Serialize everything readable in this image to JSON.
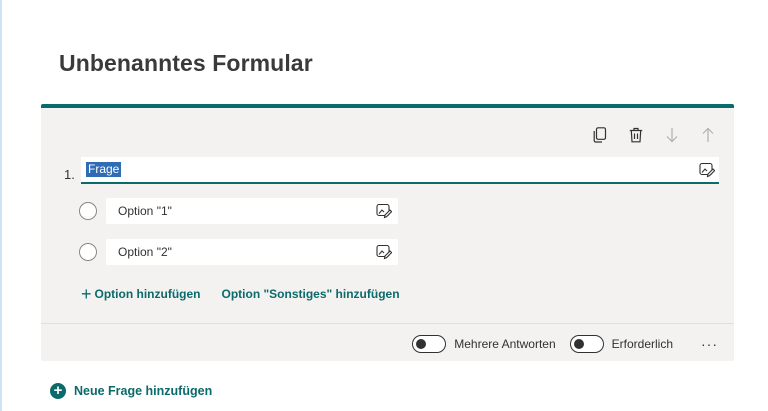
{
  "form": {
    "title": "Unbenanntes Formular"
  },
  "question": {
    "number": "1.",
    "text": "Frage",
    "options": [
      {
        "label": "Option \"1\""
      },
      {
        "label": "Option \"2\""
      }
    ],
    "add_option_label": "Option hinzufügen",
    "add_other_label": "Option \"Sonstiges\" hinzufügen",
    "toolbar_icons": [
      "copy-icon",
      "trash-icon",
      "arrow-down-icon",
      "arrow-up-icon"
    ]
  },
  "footer": {
    "multiple_answers_label": "Mehrere Antworten",
    "multiple_answers_on": false,
    "required_label": "Erforderlich",
    "required_on": false,
    "more_label": "···"
  },
  "actions": {
    "new_question_label": "Neue Frage hinzufügen"
  },
  "colors": {
    "accent": "#0b6a6a",
    "card_bg": "#f3f2f1",
    "selection": "#2f6cb5"
  }
}
